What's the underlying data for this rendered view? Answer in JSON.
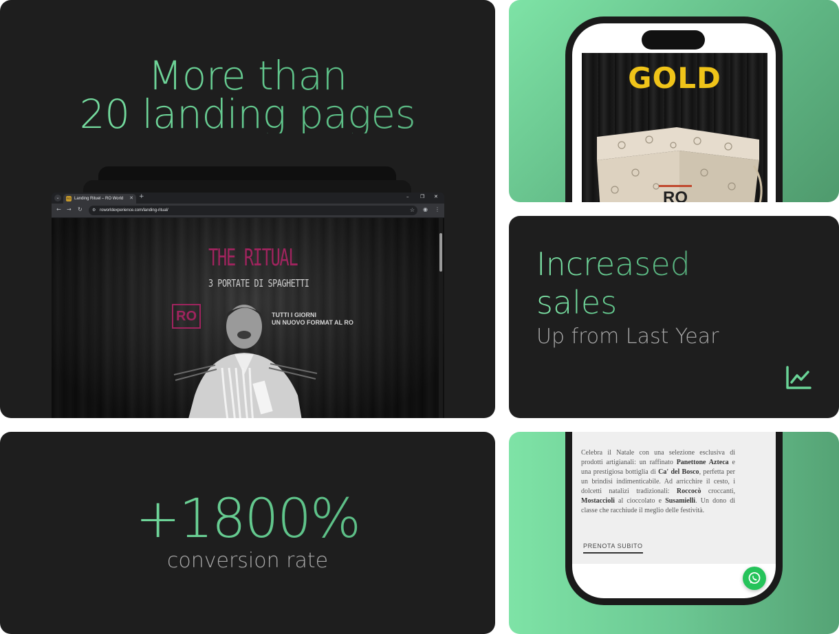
{
  "landing_card": {
    "headline_line1": "More than",
    "headline_line2": "20 landing pages",
    "browser": {
      "tab_title": "Landing Rituel – RO World",
      "tab_favicon": "RO",
      "url": "roworldexperience.com/landing-ritual/",
      "page_title": "THE RITUAL",
      "page_subtitle": "3 PORTATE DI SPAGHETTI",
      "logo_text": "RO",
      "tagline_line1": "TUTTI I GIORNI",
      "tagline_line2": "UN NUOVO FORMAT AL RO"
    }
  },
  "gold_card": {
    "gold_text": "GOLD",
    "box_logo": "RO"
  },
  "sales_card": {
    "title_line1": "Increased",
    "title_line2": "sales",
    "subtitle": "Up from Last Year",
    "icon": "trending-chart-icon"
  },
  "conversion_card": {
    "value": "+1800%",
    "label": "conversion rate"
  },
  "xmas_card": {
    "p1": "Celebra il Natale con una selezione esclusiva di prodotti artigianali: un raffinato ",
    "b1": "Panettone Azteca",
    "p2": " e una prestigiosa bottiglia di ",
    "b2": "Ca' del Bosco",
    "p3": ", perfetta per un brindisi indimenticabile. Ad arricchire il cesto, i dolcetti natalizi tradizionali: ",
    "b3": "Roccocò",
    "p4": " croccanti, ",
    "b4": "Mostaccioli",
    "p5": " al cioccolato e ",
    "b5": "Susamielli",
    "p6": ". Un dono di classe che racchiude il meglio delle festività.",
    "cta": "PRENOTA SUBITO",
    "whatsapp_icon": "whatsapp-icon"
  },
  "colors": {
    "accent_green": "#6ad497",
    "dark_card": "#1e1e1e",
    "gold": "#f0c419",
    "ritual_magenta": "#a0245e"
  }
}
